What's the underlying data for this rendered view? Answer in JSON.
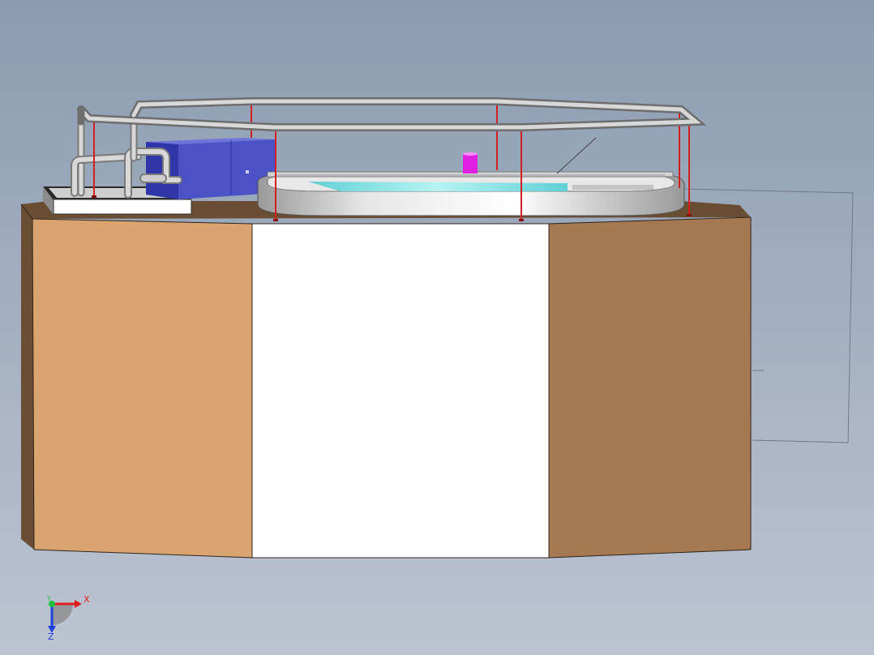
{
  "triad": {
    "x_label": "X",
    "y_label": "Y",
    "z_label": "Z"
  },
  "colors": {
    "background_top": "#8b9bb1",
    "background_bottom": "#bcc4d1",
    "wall_left": "#d9a470",
    "wall_right": "#a57a52",
    "opening": "#ffffff",
    "ground_top": "#6a4e34",
    "tank_rim": "#d6d6d6",
    "tank_water": "#7ee3e3",
    "railing": "#b0b0b0",
    "post": "#d02020",
    "blower_box": "#3e46b8",
    "pipe": "#c0c0c0",
    "marker": "#e020e0",
    "axis_x": "#e02020",
    "axis_y": "#20c040",
    "axis_z": "#2040e0"
  },
  "icons": {
    "triad": "view-orientation-triad-icon"
  }
}
